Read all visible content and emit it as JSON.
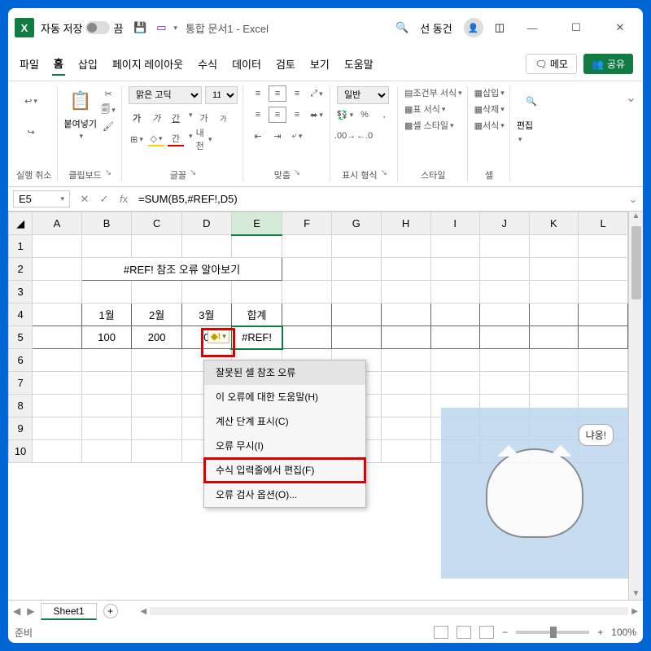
{
  "titlebar": {
    "autosave_label": "자동 저장",
    "autosave_state": "끔",
    "doc_title": "통합 문서1 - Excel",
    "user_name": "선 동건"
  },
  "tabs": {
    "items": [
      "파일",
      "홈",
      "삽입",
      "페이지 레이아웃",
      "수식",
      "데이터",
      "검토",
      "보기",
      "도움말"
    ],
    "memo": "메모",
    "share": "공유"
  },
  "ribbon": {
    "undo": "실행 취소",
    "clipboard": "클립보드",
    "paste": "붙여넣기",
    "font_group": "글꼴",
    "font_name": "맑은 고딕",
    "font_size": "11",
    "bold": "가",
    "italic": "가",
    "underline": "간",
    "topscript": "가",
    "effect": "가",
    "align": "맞춤",
    "number": "표시 형식",
    "number_format": "일반",
    "styles": "스타일",
    "cond_fmt": "조건부 서식",
    "table_fmt": "표 서식",
    "cell_style": "셀 스타일",
    "cells": "셀",
    "insert": "삽입",
    "delete": "삭제",
    "format": "서식",
    "editing": "편집"
  },
  "formula_bar": {
    "name_box": "E5",
    "formula": "=SUM(B5,#REF!,D5)"
  },
  "columns": [
    "A",
    "B",
    "C",
    "D",
    "E",
    "F",
    "G",
    "H",
    "I",
    "J",
    "K",
    "L"
  ],
  "rows": [
    "1",
    "2",
    "3",
    "4",
    "5",
    "6",
    "7",
    "8",
    "9",
    "10"
  ],
  "sheet": {
    "title_cell": "#REF! 참조 오류 알아보기",
    "headers": [
      "1월",
      "2월",
      "3월",
      "합계"
    ],
    "values": [
      "100",
      "200",
      "0",
      "#REF!"
    ],
    "d5_display": "0"
  },
  "context_menu": {
    "items": [
      "잘못된 셀 참조 오류",
      "이 오류에 대한 도움말(H)",
      "계산 단계 표시(C)",
      "오류 무시(I)",
      "수식 입력줄에서 편집(F)",
      "오류 검사 옵션(O)..."
    ]
  },
  "sheet_tabs": {
    "active": "Sheet1"
  },
  "status": {
    "ready": "준비",
    "zoom": "100%"
  },
  "overlay": {
    "bubble": "냐옹!"
  }
}
